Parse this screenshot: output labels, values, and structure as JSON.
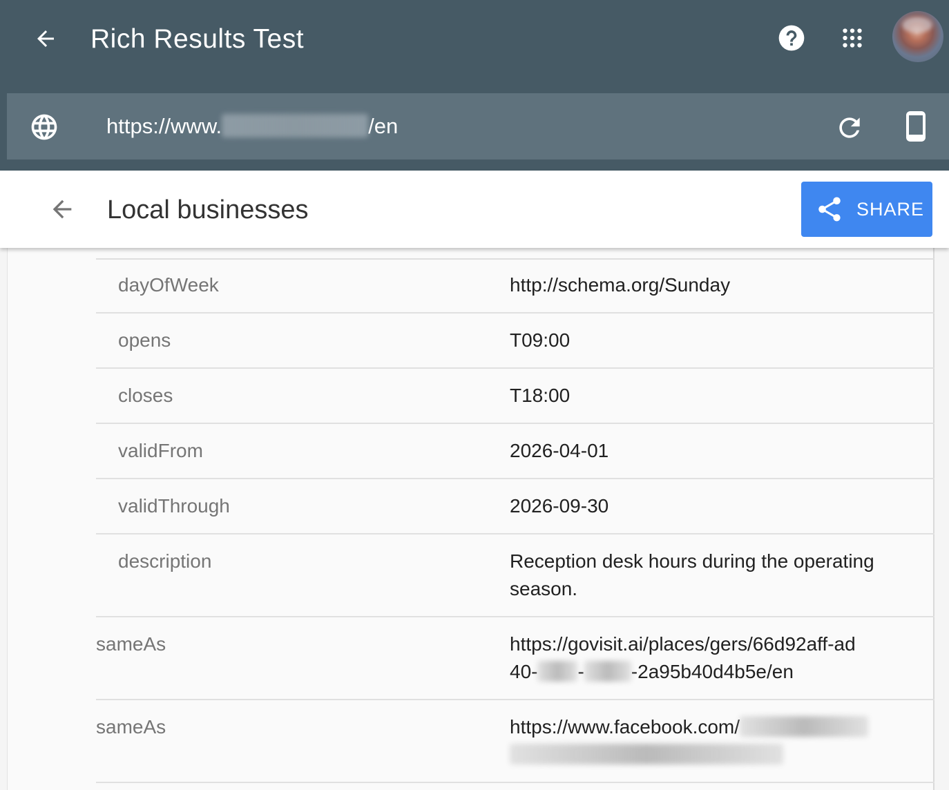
{
  "app": {
    "title": "Rich Results Test",
    "icons": {
      "back": "arrow-back-icon",
      "help": "help-icon",
      "apps": "apps-grid-icon",
      "avatar": "user-avatar"
    }
  },
  "url_bar": {
    "prefix": "https://www.",
    "suffix": "/en",
    "icons": {
      "site": "globe-icon",
      "reload": "refresh-icon",
      "device": "smartphone-icon"
    }
  },
  "section": {
    "title": "Local businesses",
    "share_label": "SHARE",
    "colors": {
      "share_button": "#3f87f0",
      "appbar": "#465a65",
      "urlbar": "#5f727d"
    }
  },
  "properties": [
    {
      "key": "dayOfWeek",
      "value": "http://schema.org/Sunday",
      "nested": true
    },
    {
      "key": "opens",
      "value": "T09:00",
      "nested": true
    },
    {
      "key": "closes",
      "value": "T18:00",
      "nested": true
    },
    {
      "key": "validFrom",
      "value": "2026-04-01",
      "nested": true
    },
    {
      "key": "validThrough",
      "value": "2026-09-30",
      "nested": true
    },
    {
      "key": "description",
      "value": "Reception desk hours during the operating season.",
      "nested": true
    },
    {
      "key": "sameAs",
      "value_line1": "https://govisit.ai/places/gers/66d92aff-ad",
      "value_line2_prefix": "40-",
      "value_line2_mid": "-",
      "value_line2_suffix": "-2a95b40d4b5e/en",
      "nested": false
    },
    {
      "key": "sameAs",
      "value_prefix": "https://www.facebook.com/",
      "nested": false
    }
  ]
}
